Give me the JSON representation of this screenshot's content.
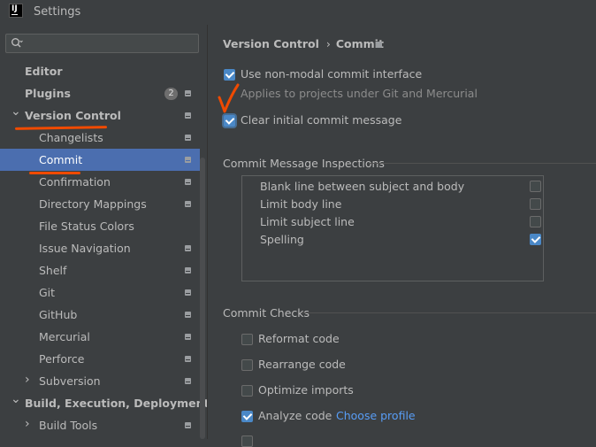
{
  "window": {
    "title": "Settings",
    "logo_text": "IJ"
  },
  "search": {
    "placeholder": ""
  },
  "sidebar": {
    "items": [
      {
        "label": "Editor",
        "level": 0,
        "bold": true,
        "expanded": null,
        "selected": false,
        "badge": "",
        "pin": false
      },
      {
        "label": "Plugins",
        "level": 0,
        "bold": true,
        "expanded": null,
        "selected": false,
        "badge": "2",
        "pin": true
      },
      {
        "label": "Version Control",
        "level": 0,
        "bold": true,
        "expanded": true,
        "selected": false,
        "badge": "",
        "pin": true
      },
      {
        "label": "Changelists",
        "level": 1,
        "bold": false,
        "expanded": null,
        "selected": false,
        "badge": "",
        "pin": true
      },
      {
        "label": "Commit",
        "level": 1,
        "bold": false,
        "expanded": null,
        "selected": true,
        "badge": "",
        "pin": true
      },
      {
        "label": "Confirmation",
        "level": 1,
        "bold": false,
        "expanded": null,
        "selected": false,
        "badge": "",
        "pin": true
      },
      {
        "label": "Directory Mappings",
        "level": 1,
        "bold": false,
        "expanded": null,
        "selected": false,
        "badge": "",
        "pin": true
      },
      {
        "label": "File Status Colors",
        "level": 1,
        "bold": false,
        "expanded": null,
        "selected": false,
        "badge": "",
        "pin": false
      },
      {
        "label": "Issue Navigation",
        "level": 1,
        "bold": false,
        "expanded": null,
        "selected": false,
        "badge": "",
        "pin": true
      },
      {
        "label": "Shelf",
        "level": 1,
        "bold": false,
        "expanded": null,
        "selected": false,
        "badge": "",
        "pin": true
      },
      {
        "label": "Git",
        "level": 1,
        "bold": false,
        "expanded": null,
        "selected": false,
        "badge": "",
        "pin": true
      },
      {
        "label": "GitHub",
        "level": 1,
        "bold": false,
        "expanded": null,
        "selected": false,
        "badge": "",
        "pin": true
      },
      {
        "label": "Mercurial",
        "level": 1,
        "bold": false,
        "expanded": null,
        "selected": false,
        "badge": "",
        "pin": true
      },
      {
        "label": "Perforce",
        "level": 1,
        "bold": false,
        "expanded": null,
        "selected": false,
        "badge": "",
        "pin": true
      },
      {
        "label": "Subversion",
        "level": 1,
        "bold": false,
        "expanded": false,
        "selected": false,
        "badge": "",
        "pin": true
      },
      {
        "label": "Build, Execution, Deployment",
        "level": 0,
        "bold": true,
        "expanded": true,
        "selected": false,
        "badge": "",
        "pin": false
      },
      {
        "label": "Build Tools",
        "level": 1,
        "bold": false,
        "expanded": false,
        "selected": false,
        "badge": "",
        "pin": true
      }
    ]
  },
  "breadcrumb": {
    "parent": "Version Control",
    "separator": "›",
    "current": "Commit"
  },
  "options": {
    "non_modal": {
      "label": "Use non-modal commit interface",
      "checked": true
    },
    "non_modal_hint": "Applies to projects under Git and Mercurial",
    "clear_initial": {
      "label": "Clear initial commit message",
      "checked": true
    }
  },
  "inspections": {
    "title": "Commit Message Inspections",
    "items": [
      {
        "label": "Blank line between subject and body",
        "checked": false
      },
      {
        "label": "Limit body line",
        "checked": false
      },
      {
        "label": "Limit subject line",
        "checked": false
      },
      {
        "label": "Spelling",
        "checked": true
      }
    ]
  },
  "checks": {
    "title": "Commit Checks",
    "items": [
      {
        "label": "Reformat code",
        "checked": false,
        "link": ""
      },
      {
        "label": "Rearrange code",
        "checked": false,
        "link": ""
      },
      {
        "label": "Optimize imports",
        "checked": false,
        "link": ""
      },
      {
        "label": "Analyze code",
        "checked": true,
        "link": "Choose profile"
      }
    ]
  },
  "colors": {
    "accent": "#4b6eaf",
    "checkbox_on": "#4a88c7",
    "link": "#589df6",
    "annotation": "#f04a00"
  }
}
